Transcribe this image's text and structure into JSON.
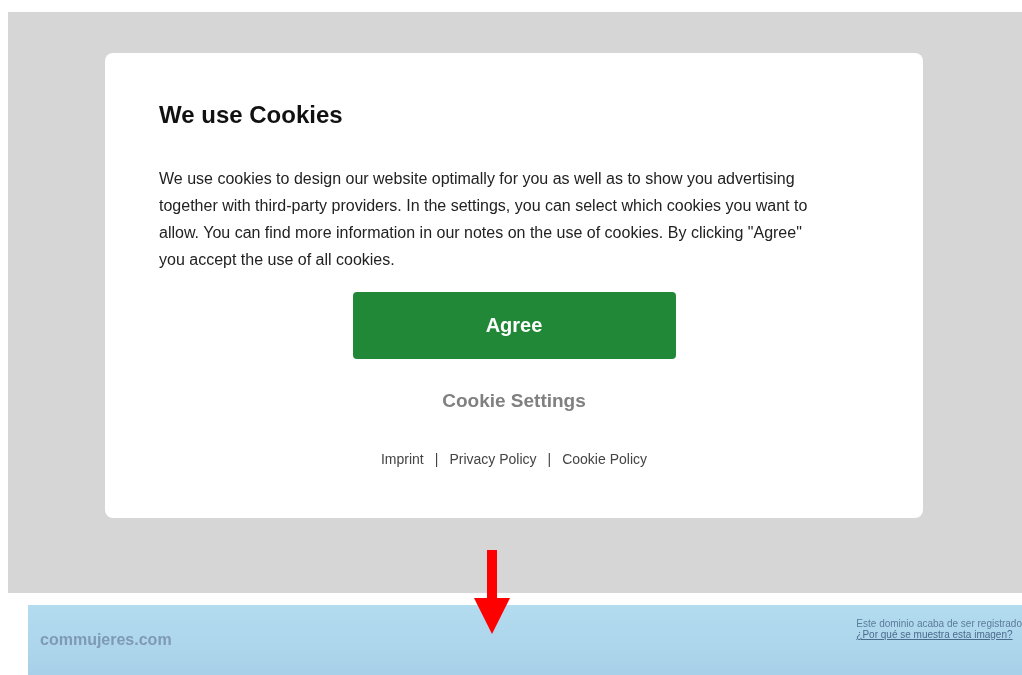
{
  "dialog": {
    "title": "We use Cookies",
    "text": "We use cookies to design our website optimally for you as well as to show you advertising together with third-party providers. In the settings, you can select which cookies you want to allow. You can find more information in our notes on the use of cookies. By clicking \"Agree\" you accept the use of all cookies.",
    "agree_button": "Agree",
    "settings_button": "Cookie Settings",
    "footer_links": [
      "Imprint",
      "Privacy Policy",
      "Cookie Policy"
    ],
    "separators": [
      "|",
      "|"
    ]
  },
  "banner": {
    "domain": "commujeres.com",
    "notice": "Este dominio acaba de ser registrado",
    "link": "¿Por qué se muestra esta imagen?"
  }
}
